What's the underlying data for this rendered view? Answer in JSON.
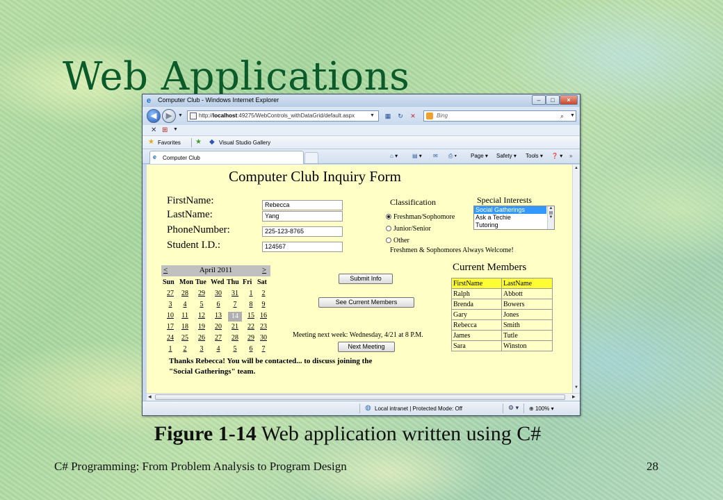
{
  "slide": {
    "title": "Web Applications",
    "caption_bold": "Figure 1-14",
    "caption_text": " Web application written using C#",
    "footer_left": "C# Programming: From Problem Analysis to Program Design",
    "footer_right": "28"
  },
  "browser": {
    "window_title": "Computer Club - Windows Internet Explorer",
    "url_prefix": "http://",
    "url_host": "localhost",
    "url_rest": ":49275/WebControls_withDataGrid/default.aspx",
    "search_placeholder": "Bing",
    "favorites_label": "Favorites",
    "favorites_link": "Visual Studio Gallery",
    "tab_label": "Computer Club",
    "tools": {
      "page": "Page",
      "safety": "Safety",
      "tools": "Tools"
    },
    "status_zone": "Local intranet | Protected Mode: Off",
    "zoom": "100%"
  },
  "form": {
    "title": "Computer Club Inquiry Form",
    "labels": {
      "first": "FirstName:",
      "last": "LastName:",
      "phone": "PhoneNumber:",
      "student": "Student I.D.:"
    },
    "values": {
      "first": "Rebecca",
      "last": "Yang",
      "phone": "225-123-8765",
      "student": "124567"
    },
    "classification_label": "Classification",
    "classifications": [
      "Freshman/Sophomore",
      "Junior/Senior",
      "Other"
    ],
    "selected_classification": "Freshman/Sophomore",
    "interests_label": "Special Interests",
    "interests": [
      "Social Gatherings",
      "Ask a Techie",
      "Tutoring"
    ],
    "selected_interest": "Social Gatherings",
    "welcome": "Freshmen & Sophomores Always Welcome!",
    "submit_label": "Submit Info",
    "see_members_label": "See Current Members",
    "meeting_text": "Meeting next week: Wednesday, 4/21 at 8 P.M.",
    "next_meeting_label": "Next Meeting",
    "thanks_line1": "Thanks Rebecca! You will be contacted... to discuss joining the",
    "thanks_line2": "\"Social Gatherings\" team."
  },
  "calendar": {
    "prev": "<",
    "next": ">",
    "month": "April 2011",
    "dow": [
      "Sun",
      "Mon",
      "Tue",
      "Wed",
      "Thu",
      "Fri",
      "Sat"
    ],
    "weeks": [
      [
        "27",
        "28",
        "29",
        "30",
        "31",
        "1",
        "2"
      ],
      [
        "3",
        "4",
        "5",
        "6",
        "7",
        "8",
        "9"
      ],
      [
        "10",
        "11",
        "12",
        "13",
        "14",
        "15",
        "16"
      ],
      [
        "17",
        "18",
        "19",
        "20",
        "21",
        "22",
        "23"
      ],
      [
        "24",
        "25",
        "26",
        "27",
        "28",
        "29",
        "30"
      ],
      [
        "1",
        "2",
        "3",
        "4",
        "5",
        "6",
        "7"
      ]
    ],
    "selected": "14"
  },
  "members": {
    "title": "Current Members",
    "headers": [
      "FirstName",
      "LastName"
    ],
    "rows": [
      [
        "Ralph",
        "Abbott"
      ],
      [
        "Brenda",
        "Bowers"
      ],
      [
        "Gary",
        "Jones"
      ],
      [
        "Rebecca",
        "Smith"
      ],
      [
        "James",
        "Tutle"
      ],
      [
        "Sara",
        "Winston"
      ]
    ]
  }
}
